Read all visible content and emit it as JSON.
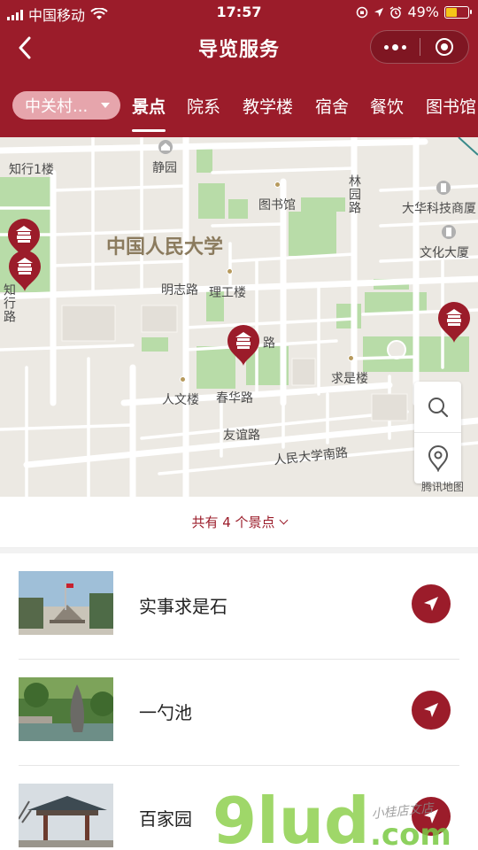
{
  "status": {
    "carrier": "中国移动",
    "time": "17:57",
    "battery": "49%",
    "battery_level": 0.49
  },
  "nav": {
    "title": "导览服务"
  },
  "campus": {
    "label": "中关村..."
  },
  "tabs": [
    {
      "label": "景点",
      "active": true
    },
    {
      "label": "院系"
    },
    {
      "label": "教学楼"
    },
    {
      "label": "宿舍"
    },
    {
      "label": "餐饮"
    },
    {
      "label": "图书馆"
    }
  ],
  "map": {
    "labels": {
      "zhixing1": "知行1楼",
      "jingyuan": "静园",
      "library": "图书馆",
      "linyuan": "林园路",
      "dahua": "大华科技商厦",
      "ruc": "中国人民大学",
      "wenhua": "文化大厦",
      "mingzhi": "明志路",
      "ligong": "理工楼",
      "zhixing_road": "知行路",
      "road_lu": "路",
      "qiushi": "求是楼",
      "renwen": "人文楼",
      "chunhua": "春华路",
      "youyi": "友谊路",
      "rucsouth": "人民大学南路"
    },
    "provider": "腾讯地图",
    "colors": {
      "pin": "#9b1c2a",
      "green": "#b8dca8",
      "water": "#d8e6ef"
    }
  },
  "count": {
    "text": "共有 4 个景点"
  },
  "spots": [
    {
      "name": "实事求是石"
    },
    {
      "name": "一勺池"
    },
    {
      "name": "百家园"
    }
  ],
  "watermark": {
    "logo": "9lud",
    "suffix": ".com",
    "slogan": "小桂店文店"
  },
  "theme": {
    "primary": "#9b1c2a"
  }
}
